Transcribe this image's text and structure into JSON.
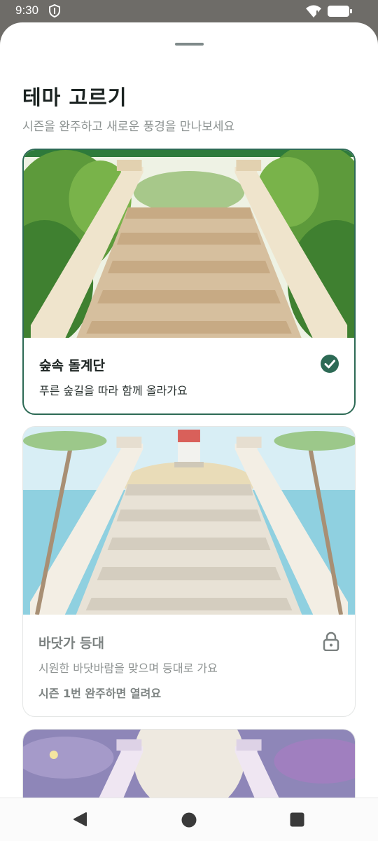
{
  "status_bar": {
    "time": "9:30"
  },
  "sheet": {
    "title": "테마 고르기",
    "subtitle": "시즌을 완주하고 새로운 풍경을 만나보세요"
  },
  "themes": [
    {
      "name": "숲속 돌계단",
      "description": "푸른 숲길을 따라 함께 올라가요",
      "state": "selected",
      "status_icon": "check-circle-icon"
    },
    {
      "name": "바닷가 등대",
      "description": "시원한 바닷바람을 맞으며 등대로 가요",
      "requirement": "시즌 1번 완주하면 열려요",
      "state": "locked",
      "status_icon": "lock-icon"
    },
    {
      "state": "partially-visible"
    }
  ],
  "colors": {
    "accent": "#2d6a55",
    "forest": "#5a9a3c",
    "sea": "#8fd0e0",
    "night": "#8e86b8"
  }
}
